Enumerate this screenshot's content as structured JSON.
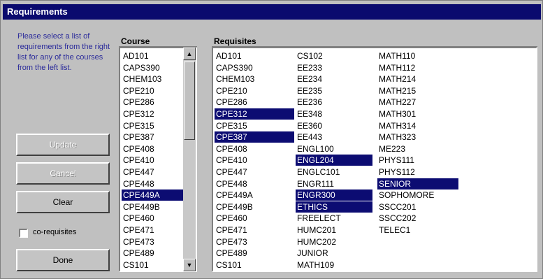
{
  "window": {
    "title": "Requirements"
  },
  "help_text": "Please select a list of requirements from the right list for any of the courses from the left list.",
  "buttons": {
    "update": "Update",
    "cancel": "Cancel",
    "clear": "Clear",
    "done": "Done"
  },
  "checkbox": {
    "label": "co-requisites",
    "checked": false
  },
  "course_list": {
    "header": "Course",
    "items": [
      "AD101",
      "CAPS390",
      "CHEM103",
      "CPE210",
      "CPE286",
      "CPE312",
      "CPE315",
      "CPE387",
      "CPE408",
      "CPE410",
      "CPE447",
      "CPE448",
      "CPE449A",
      "CPE449B",
      "CPE460",
      "CPE471",
      "CPE473",
      "CPE489",
      "CS101"
    ],
    "selected": [
      "CPE449A"
    ]
  },
  "requisites_list": {
    "header": "Requisites",
    "columns": [
      [
        "AD101",
        "CAPS390",
        "CHEM103",
        "CPE210",
        "CPE286",
        "CPE312",
        "CPE315",
        "CPE387",
        "CPE408",
        "CPE410",
        "CPE447",
        "CPE448",
        "CPE449A",
        "CPE449B",
        "CPE460",
        "CPE471",
        "CPE473",
        "CPE489",
        "CS101"
      ],
      [
        "CS102",
        "EE233",
        "EE234",
        "EE235",
        "EE236",
        "EE348",
        "EE360",
        "EE443",
        "ENGL100",
        "ENGL204",
        "ENGLC101",
        "ENGR111",
        "ENGR300",
        "ETHICS",
        "FREELECT",
        "HUMC201",
        "HUMC202",
        "JUNIOR",
        "MATH109"
      ],
      [
        "MATH110",
        "MATH112",
        "MATH214",
        "MATH215",
        "MATH227",
        "MATH301",
        "MATH314",
        "MATH323",
        "ME223",
        "PHYS111",
        "PHYS112",
        "SENIOR",
        "SOPHOMORE",
        "SSCC201",
        "SSCC202",
        "TELEC1"
      ]
    ],
    "selected": [
      "CPE312",
      "CPE387",
      "ENGL204",
      "ENGR300",
      "ETHICS",
      "SENIOR"
    ]
  },
  "colors": {
    "title_bar": "#0a0a6e",
    "selection": "#0c0c72",
    "help_text": "#2a2a9a"
  }
}
